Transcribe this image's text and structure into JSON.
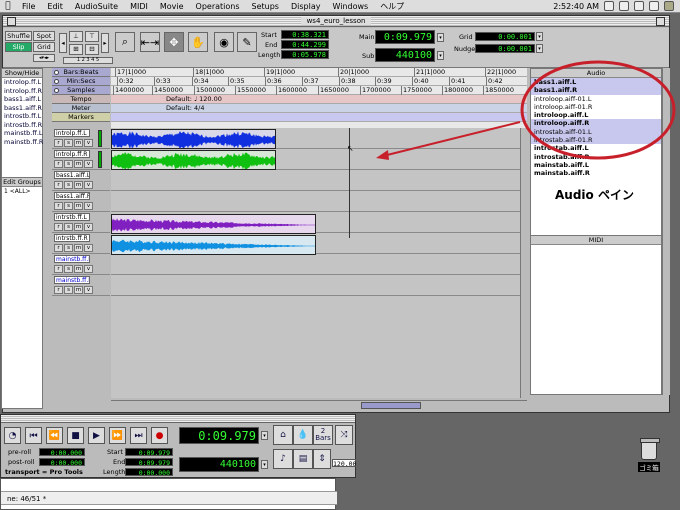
{
  "menubar": {
    "items": [
      "File",
      "Edit",
      "AudioSuite",
      "MIDI",
      "Movie",
      "Operations",
      "Setups",
      "Display",
      "Windows",
      "ヘルプ"
    ],
    "clock": "2:52:40 AM"
  },
  "window": {
    "title": "ws4_euro_lesson"
  },
  "toolbar": {
    "modes": {
      "shuffle": "Shuffle",
      "spot": "Spot",
      "slip": "Slip",
      "grid": "Grid"
    },
    "start_label": "Start",
    "end_label": "End",
    "length_label": "Length",
    "start": "0:38.321",
    "end": "0:44.299",
    "length": "0:05.978",
    "main_label": "Main",
    "sub_label": "Sub",
    "main": "0:09.979",
    "sub": "440100",
    "grid_label": "Grid",
    "nudge_label": "Nudge",
    "grid": "0:00.001",
    "nudge": "0:00.001"
  },
  "rulers": {
    "labels": [
      "Bars:Beats",
      "Min:Secs",
      "Samples",
      "Tempo",
      "Meter",
      "Markers"
    ],
    "bars": [
      "17|1|000",
      "18|1|000",
      "19|1|000",
      "20|1|000",
      "21|1|000",
      "22|1|000"
    ],
    "minsecs": [
      "0:32",
      "0:33",
      "0:34",
      "0:35",
      "0:36",
      "0:37",
      "0:38",
      "0:39",
      "0:40",
      "0:41",
      "0:42"
    ],
    "samples": [
      "1400000",
      "1450000",
      "1500000",
      "1550000",
      "1600000",
      "1650000",
      "1700000",
      "1750000",
      "1800000",
      "1850000"
    ],
    "tempo": "Default: ♩ 120.00",
    "meter": "Default: 4/4"
  },
  "showhide": {
    "title": "Show/Hide",
    "items": [
      "introlop.ff.L",
      "introlop.ff.R",
      "bass1.aiff.L",
      "bass1.aiff.R",
      "introstb.ff.L",
      "introstb.ff.R",
      "mainstb.ff.L",
      "mainstb.ff.R"
    ]
  },
  "editgroups": {
    "title": "Edit Groups",
    "items": [
      "1 <ALL>"
    ]
  },
  "tracks": [
    {
      "name": "introlp.ff.L",
      "blue": false
    },
    {
      "name": "introlp.ff.R",
      "blue": false
    },
    {
      "name": "bass1.aiff.L",
      "blue": false
    },
    {
      "name": "bass1.aiff.R",
      "blue": false
    },
    {
      "name": "intrstb.ff.L",
      "blue": false
    },
    {
      "name": "intrstb.ff.R",
      "blue": false
    },
    {
      "name": "mainstb.ff.L",
      "blue": true
    },
    {
      "name": "mainstb.ff.R",
      "blue": true
    }
  ],
  "audio_pane": {
    "title": "Audio",
    "items": [
      {
        "name": "bass1.aiff.L",
        "hl": true,
        "bold": true
      },
      {
        "name": "bass1.aiff.R",
        "hl": true,
        "bold": true
      },
      {
        "name": "introloop.aiff-01.L",
        "hl": false,
        "bold": false
      },
      {
        "name": "introloop.aiff-01.R",
        "hl": false,
        "bold": false
      },
      {
        "name": "introloop.aiff.L",
        "hl": false,
        "bold": true
      },
      {
        "name": "introloop.aiff.R",
        "hl": true,
        "bold": true
      },
      {
        "name": "introstab.aiff-01.L",
        "hl": true,
        "bold": false
      },
      {
        "name": "introstab.aiff-01.R",
        "hl": true,
        "bold": false
      },
      {
        "name": "introstab.aiff.L",
        "hl": false,
        "bold": true
      },
      {
        "name": "introstab.aiff.R",
        "hl": false,
        "bold": true
      },
      {
        "name": "mainstab.aiff.L",
        "hl": false,
        "bold": true
      },
      {
        "name": "mainstab.aiff.R",
        "hl": false,
        "bold": true
      }
    ],
    "caption": "Audio ペイン"
  },
  "midi_pane": {
    "title": "MIDI"
  },
  "transport": {
    "preroll_label": "pre-roll",
    "postroll_label": "post-roll",
    "preroll": "0:00.000",
    "postroll": "0:00.000",
    "start_label": "Start",
    "end_label": "End",
    "length_label": "Length",
    "start": "0:09.979",
    "end": "0:09.979",
    "length": "0:00.000",
    "main": "0:09.979",
    "sub": "440100",
    "transport_label": "transport = Pro Tools",
    "bars_label": "Bars",
    "bars_value": "2",
    "tempo": "120.00"
  },
  "docwin": {
    "text": "ne: 46/51 *"
  },
  "trash": {
    "label": "ゴミ箱"
  },
  "colors": {
    "annotation": "#c8202a",
    "waveform_blue": "#1030e0",
    "waveform_green": "#10c010",
    "waveform_purple": "#8020c0",
    "waveform_cyan": "#1090e0"
  }
}
